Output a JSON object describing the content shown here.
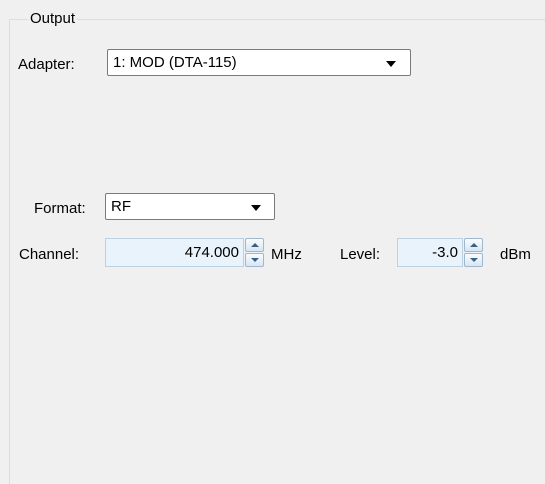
{
  "group": {
    "title": "Output"
  },
  "adapter": {
    "label": "Adapter:",
    "value": "1: MOD (DTA-115)"
  },
  "format": {
    "label": "Format:",
    "value": "RF"
  },
  "channel": {
    "label": "Channel:",
    "value": "474.000",
    "unit": "MHz"
  },
  "level": {
    "label": "Level:",
    "value": "-3.0",
    "unit": "dBm"
  }
}
